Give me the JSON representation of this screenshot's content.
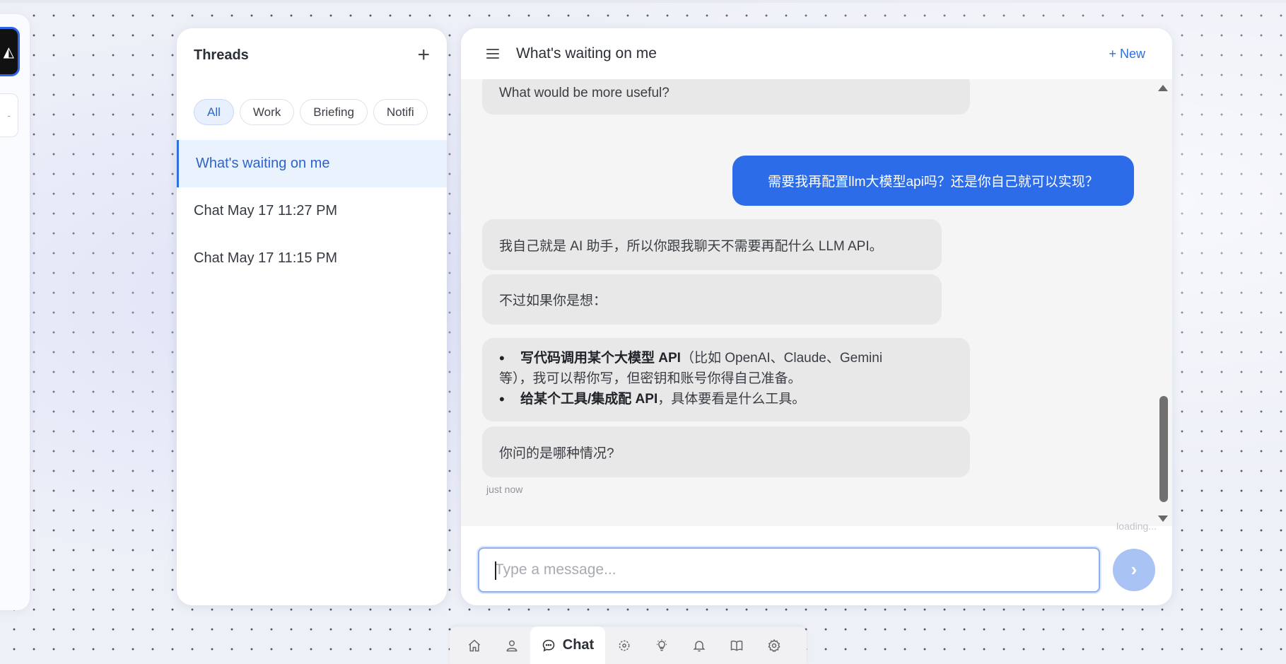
{
  "threads": {
    "title": "Threads",
    "add_label": "+",
    "filters": [
      "All",
      "Work",
      "Briefing",
      "Notifi"
    ],
    "items": [
      {
        "label": "What's waiting on me"
      },
      {
        "label": "Chat May 17 11:27 PM"
      },
      {
        "label": "Chat May 17 11:15 PM"
      }
    ]
  },
  "chat": {
    "title": "What's waiting on me",
    "new_label": "+ New",
    "messages": {
      "m0": "What would be more useful?",
      "m1": "需要我再配置llm大模型api吗？还是你自己就可以实现？",
      "m2": "我自己就是 AI 助手，所以你跟我聊天不需要再配什么 LLM API。",
      "m3": "不过如果你是想：",
      "m4": {
        "b1_bold": "写代码调用某个大模型 API",
        "b1_rest": "（比如 OpenAI、Claude、Gemini",
        "b1_cont": "等），我可以帮你写，但密钥和账号你得自己准备。",
        "b2_bold": "给某个工具/集成配 API",
        "b2_rest": "，具体要看是什么工具。"
      },
      "m5": "你问的是哪种情况?"
    },
    "timestamp": "just now",
    "loading": "loading...",
    "input_placeholder": "Type a message...",
    "send_icon": "›"
  },
  "rail": {
    "logo_icon": "app-logo-icon",
    "btn_label": "-"
  },
  "nav": {
    "items": [
      "home-icon",
      "user-icon",
      "chat-icon",
      "focus-icon",
      "lightbulb-icon",
      "bell-icon",
      "book-icon",
      "gear-icon"
    ],
    "chat_label": "Chat"
  },
  "colors": {
    "accent": "#2d6ce8",
    "active_thread_bg": "#eaf2fe",
    "assistant_bubble": "#e8e8e8",
    "send_button": "#a9c3f4"
  }
}
